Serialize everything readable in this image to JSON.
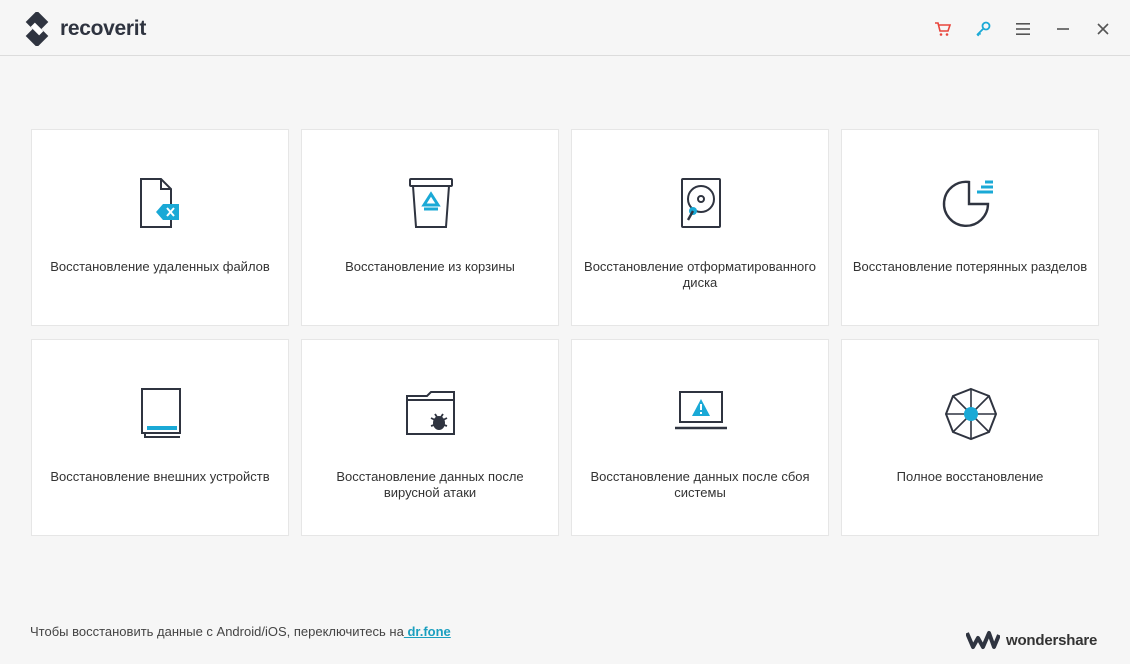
{
  "app": {
    "name": "recoverit"
  },
  "colors": {
    "accent": "#1aa9d6",
    "cart": "#e8453c",
    "dark": "#2f3440"
  },
  "window_controls": [
    {
      "name": "cart-icon"
    },
    {
      "name": "key-icon"
    },
    {
      "name": "menu-icon"
    },
    {
      "name": "minimize-icon"
    },
    {
      "name": "close-icon"
    }
  ],
  "cards": [
    {
      "label": "Восстановление удаленных файлов",
      "icon": "deleted-file-icon"
    },
    {
      "label": "Восстановление из корзины",
      "icon": "recycle-bin-icon"
    },
    {
      "label": "Восстановление отформатированного диска",
      "icon": "formatted-disk-icon"
    },
    {
      "label": "Восстановление потерянных разделов",
      "icon": "lost-partition-icon"
    },
    {
      "label": "Восстановление внешних устройств",
      "icon": "external-device-icon"
    },
    {
      "label": "Восстановление данных после вирусной атаки",
      "icon": "virus-folder-icon"
    },
    {
      "label": "Восстановление данных после сбоя системы",
      "icon": "system-crash-icon"
    },
    {
      "label": "Полное восстановление",
      "icon": "all-around-icon"
    }
  ],
  "footer": {
    "text": "Чтобы восстановить данные с Android/iOS, переключитесь на",
    "link": " dr.fone"
  },
  "brand": {
    "name": "wondershare"
  }
}
